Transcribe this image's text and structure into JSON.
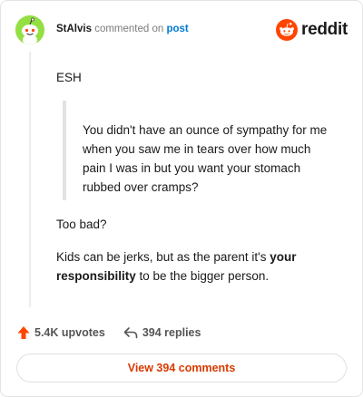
{
  "header": {
    "username": "StAlvis",
    "action_text": "commented on",
    "link_text": "post",
    "brand": "reddit"
  },
  "comment": {
    "line1": "ESH",
    "quote": "You didn't have an ounce of sympathy for me when you saw me in tears over how much pain I was in but you want your stomach rubbed over cramps?",
    "line2": "Too bad?",
    "line3_part1": "Kids can be jerks, but as the parent it's ",
    "line3_bold1": "your responsibility",
    "line3_part2": " to be the bigger person."
  },
  "footer": {
    "upvotes": "5.4K upvotes",
    "replies": "394 replies",
    "cta": "View 394 comments"
  },
  "colors": {
    "brand": "#ff4500",
    "upvote": "#ff4500",
    "link": "#0079d3",
    "cta_text": "#d93a00",
    "avatar_bg": "#94e044"
  }
}
